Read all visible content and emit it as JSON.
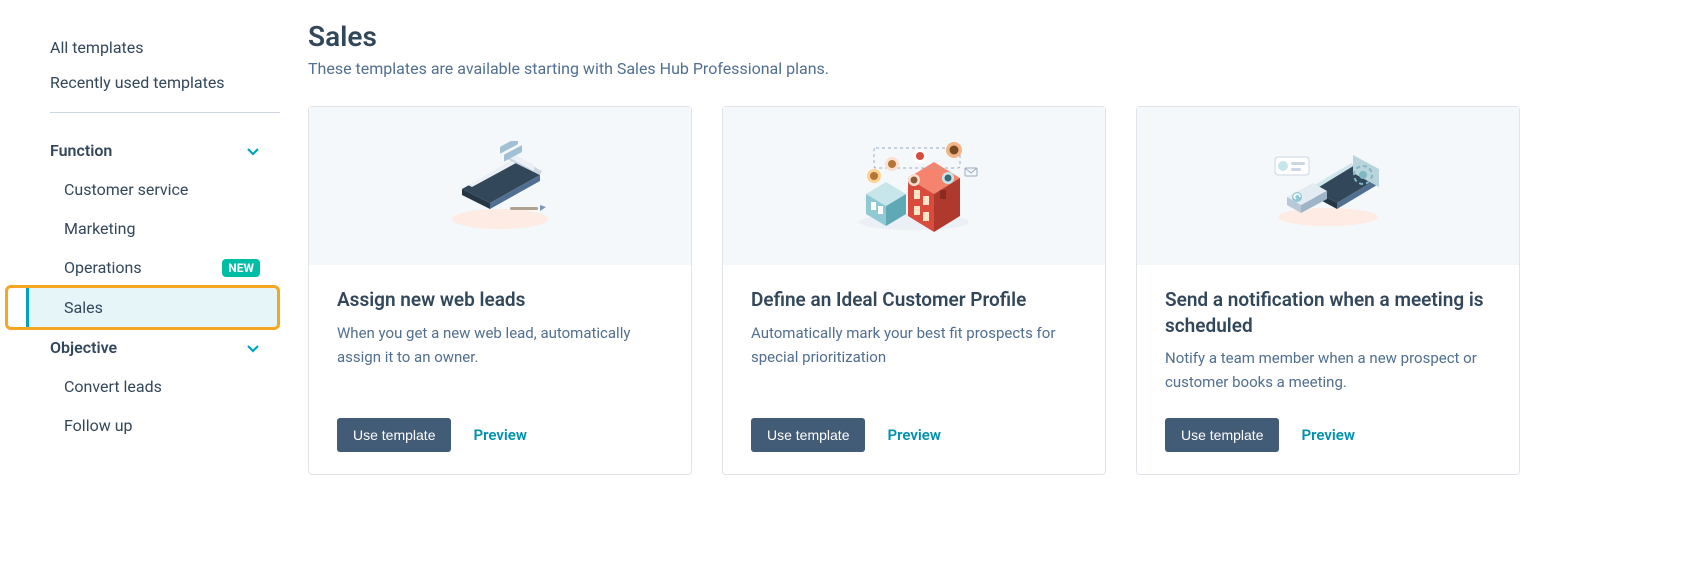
{
  "sidebar": {
    "nav_links": [
      "All templates",
      "Recently used templates"
    ],
    "sections": [
      {
        "label": "Function",
        "expanded": true,
        "items": [
          {
            "label": "Customer service",
            "badge": null,
            "active": false
          },
          {
            "label": "Marketing",
            "badge": null,
            "active": false
          },
          {
            "label": "Operations",
            "badge": "NEW",
            "active": false
          },
          {
            "label": "Sales",
            "badge": null,
            "active": true
          }
        ]
      },
      {
        "label": "Objective",
        "expanded": true,
        "items": [
          {
            "label": "Convert leads",
            "badge": null,
            "active": false
          },
          {
            "label": "Follow up",
            "badge": null,
            "active": false
          }
        ]
      }
    ]
  },
  "main": {
    "title": "Sales",
    "subtitle": "These templates are available starting with Sales Hub Professional plans.",
    "cards": [
      {
        "title": "Assign new web leads",
        "desc": "When you get a new web lead, automatically assign it to an owner.",
        "button": "Use template",
        "preview": "Preview",
        "icon": "laptop-illus"
      },
      {
        "title": "Define an Ideal Customer Profile",
        "desc": "Automatically mark your best fit prospects for special prioritization",
        "button": "Use template",
        "preview": "Preview",
        "icon": "buildings-illus"
      },
      {
        "title": "Send a notification when a meeting is scheduled",
        "desc": "Notify a team member when a new prospect or customer books a meeting.",
        "button": "Use template",
        "preview": "Preview",
        "icon": "devices-illus"
      }
    ]
  }
}
